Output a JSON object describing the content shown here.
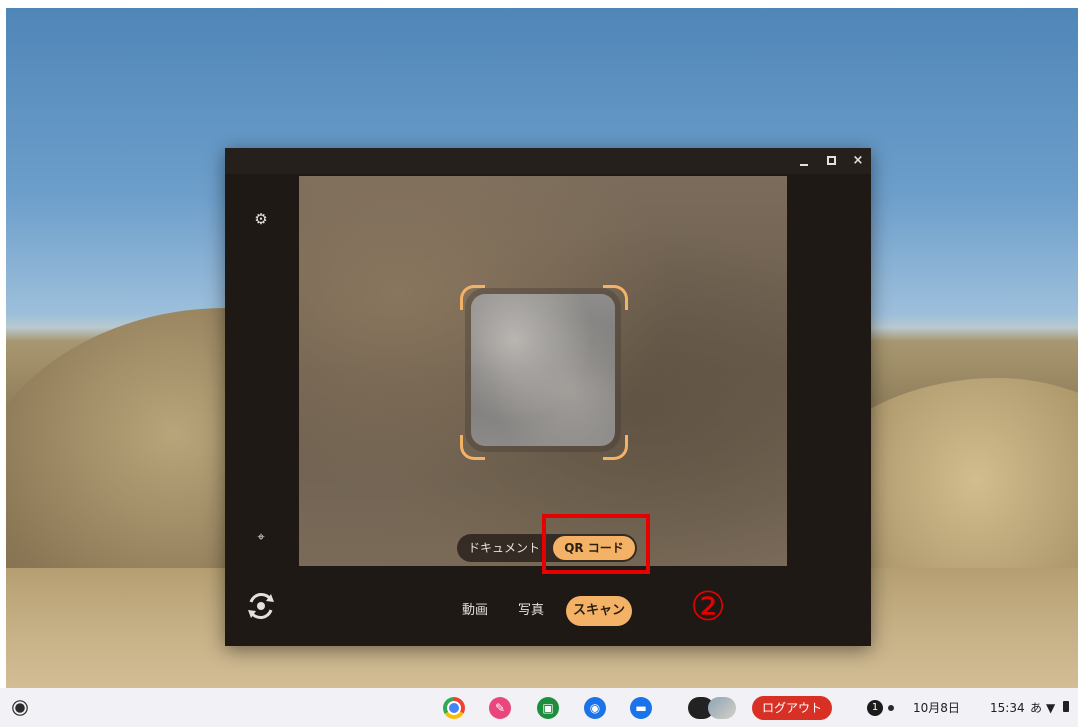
{
  "camera_window": {
    "controls": {
      "minimize": "minimize-icon",
      "maximize": "maximize-icon",
      "close_label": "×"
    },
    "scan_types": [
      {
        "label": "ドキュメント",
        "selected": false
      },
      {
        "label": "QR コード",
        "selected": true
      }
    ],
    "modes": [
      {
        "label": "動画",
        "selected": false
      },
      {
        "label": "写真",
        "selected": false
      },
      {
        "label": "スキャン",
        "selected": true
      }
    ],
    "icons": {
      "settings": "gear-icon",
      "ptz": "pan-tilt-icon",
      "switch_camera": "switch-camera-icon"
    },
    "accent": "#f3b266"
  },
  "annotation": {
    "step_label": "②",
    "color": "#e60000"
  },
  "shelf": {
    "apps": [
      "chrome",
      "canvas",
      "classroom",
      "camera",
      "files"
    ],
    "logout_label": "ログアウト",
    "notification_count": "1",
    "date": "10月8日",
    "time": "15:34",
    "ime": "あ"
  }
}
